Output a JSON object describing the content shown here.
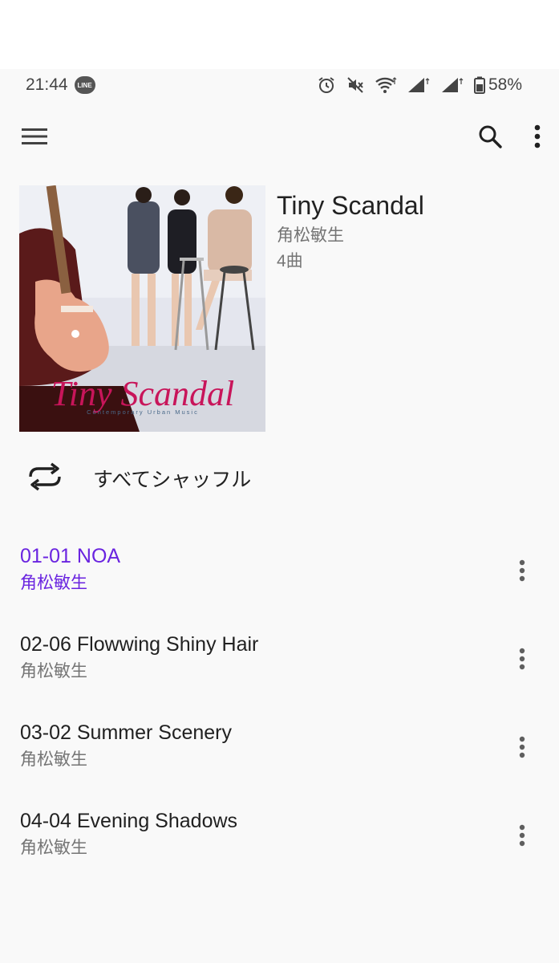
{
  "status_bar": {
    "time": "21:44",
    "notification_app": "LINE",
    "battery": "58%",
    "icons": [
      "alarm-icon",
      "mute-icon",
      "wifi-icon",
      "signal-icon",
      "signal-icon",
      "battery-icon"
    ]
  },
  "toolbar": {
    "menu_icon": "menu-icon",
    "search_icon": "search-icon",
    "more_icon": "more-vert-icon"
  },
  "album": {
    "title": "Tiny Scandal",
    "artist": "角松敏生",
    "track_count": "4曲",
    "art_text": "Tiny Scandal",
    "art_subtext": "Contemporary Urban Music"
  },
  "shuffle": {
    "label": "すべてシャッフル",
    "icon": "shuffle-icon"
  },
  "tracks": [
    {
      "title": "01-01 NOA",
      "artist": "角松敏生",
      "playing": true
    },
    {
      "title": "02-06 Flowwing Shiny Hair",
      "artist": "角松敏生",
      "playing": false
    },
    {
      "title": "03-02 Summer Scenery",
      "artist": "角松敏生",
      "playing": false
    },
    {
      "title": "04-04 Evening Shadows",
      "artist": "角松敏生",
      "playing": false
    }
  ],
  "colors": {
    "accent": "#6a24e0",
    "text_primary": "#212121",
    "text_secondary": "#757575",
    "background": "#f9f9f9"
  }
}
